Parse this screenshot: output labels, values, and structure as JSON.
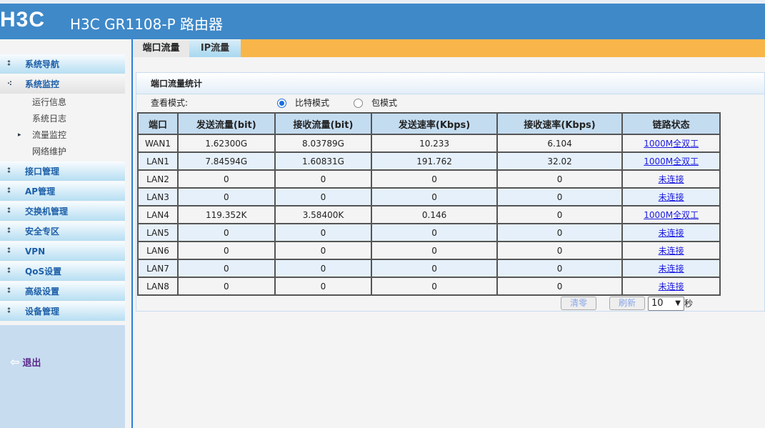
{
  "header": {
    "logo": "H3C",
    "title": "H3C GR1108-P 路由器"
  },
  "sidebar": {
    "items": [
      {
        "label": "系统导航"
      },
      {
        "label": "系统监控"
      }
    ],
    "subitems": [
      {
        "label": "运行信息"
      },
      {
        "label": "系统日志"
      },
      {
        "label": "流量监控",
        "active": true
      },
      {
        "label": "网络维护"
      }
    ],
    "items2": [
      {
        "label": "接口管理"
      },
      {
        "label": "AP管理"
      },
      {
        "label": "交换机管理"
      },
      {
        "label": "安全专区"
      },
      {
        "label": "VPN"
      },
      {
        "label": "QoS设置"
      },
      {
        "label": "高级设置"
      },
      {
        "label": "设备管理"
      }
    ],
    "logout": "退出"
  },
  "tabs": [
    {
      "label": "端口流量",
      "active": true
    },
    {
      "label": "IP流量"
    }
  ],
  "panel": {
    "title": "端口流量统计",
    "mode_label": "查看模式:",
    "modes": [
      {
        "label": "比特模式",
        "checked": true
      },
      {
        "label": "包模式",
        "checked": false
      }
    ],
    "columns": [
      "端口",
      "发送流量(bit)",
      "接收流量(bit)",
      "发送速率(Kbps)",
      "接收速率(Kbps)",
      "链路状态"
    ],
    "rows": [
      [
        "WAN1",
        "1.62300G",
        "8.03789G",
        "10.233",
        "6.104",
        "1000M全双工"
      ],
      [
        "LAN1",
        "7.84594G",
        "1.60831G",
        "191.762",
        "32.02",
        "1000M全双工"
      ],
      [
        "LAN2",
        "0",
        "0",
        "0",
        "0",
        "未连接"
      ],
      [
        "LAN3",
        "0",
        "0",
        "0",
        "0",
        "未连接"
      ],
      [
        "LAN4",
        "119.352K",
        "3.58400K",
        "0.146",
        "0",
        "1000M全双工"
      ],
      [
        "LAN5",
        "0",
        "0",
        "0",
        "0",
        "未连接"
      ],
      [
        "LAN6",
        "0",
        "0",
        "0",
        "0",
        "未连接"
      ],
      [
        "LAN7",
        "0",
        "0",
        "0",
        "0",
        "未连接"
      ],
      [
        "LAN8",
        "0",
        "0",
        "0",
        "0",
        "未连接"
      ]
    ],
    "clear_label": "清零",
    "refresh_label": "刷新",
    "interval": "10",
    "unit": "秒"
  }
}
